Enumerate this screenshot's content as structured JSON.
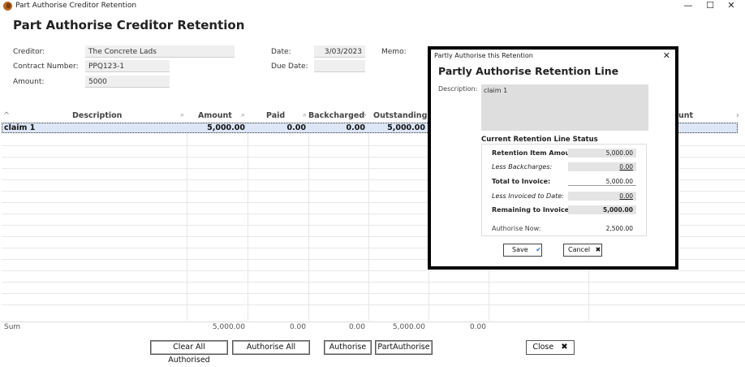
{
  "window": {
    "title": "Part Authorise Creditor Retention",
    "minimize": "—",
    "maximize": "☐",
    "close": "✕"
  },
  "page_heading": "Part Authorise Creditor Retention",
  "form": {
    "creditor_label": "Creditor:",
    "creditor_value": "The Concrete Lads",
    "contract_label": "Contract Number:",
    "contract_value": "PPQ123-1",
    "amount_label": "Amount:",
    "amount_value": "5000",
    "date_label": "Date:",
    "date_value": "3/03/2023",
    "due_label": "Due Date:",
    "due_value": "",
    "memo_label": "Memo:"
  },
  "grid": {
    "sort_icon": "^",
    "search_icon": "⌕",
    "scroll_right": "›",
    "headers": {
      "description": "Description",
      "amount": "Amount",
      "paid": "Paid",
      "backcharged": "Backcharged",
      "outstanding": "Outstanding",
      "amount_partial": "unt"
    },
    "rows": [
      {
        "description": "claim 1",
        "amount": "5,000.00",
        "paid": "0.00",
        "backcharged": "0.00",
        "outstanding": "5,000.00"
      }
    ],
    "sum": {
      "label": "Sum",
      "amount": "5,000.00",
      "paid": "0.00",
      "backcharged": "0.00",
      "outstanding": "5,000.00",
      "authorised": "0.00"
    }
  },
  "buttons": {
    "clear_all": "Clear All Authorised",
    "authorise_all": "Authorise All",
    "authorise": "Authorise",
    "part_authorise": "PartAuthorise",
    "close": "Close",
    "close_icon": "✖"
  },
  "dialog": {
    "window_title": "Partly Authorise this Retention",
    "close": "✕",
    "heading": "Partly Authorise Retention Line",
    "description_label": "Description:",
    "description_value": "claim 1",
    "status_title": "Current Retention Line Status",
    "rows": [
      {
        "label": "Retention Item Amount:",
        "value": "5,000.00"
      },
      {
        "label": "Less Backcharges:",
        "value": "0.00"
      },
      {
        "label": "Total to Invoice:",
        "value": "5,000.00"
      },
      {
        "label": "Less Invoiced to Date:",
        "value": "0.00"
      },
      {
        "label": "Remaining to Invoice:",
        "value": "5,000.00"
      }
    ],
    "authorise_now_label": "Authorise Now:",
    "authorise_now_value": "2,500.00",
    "save": "Save",
    "save_icon": "✔",
    "cancel": "Cancel",
    "cancel_icon": "✖"
  }
}
